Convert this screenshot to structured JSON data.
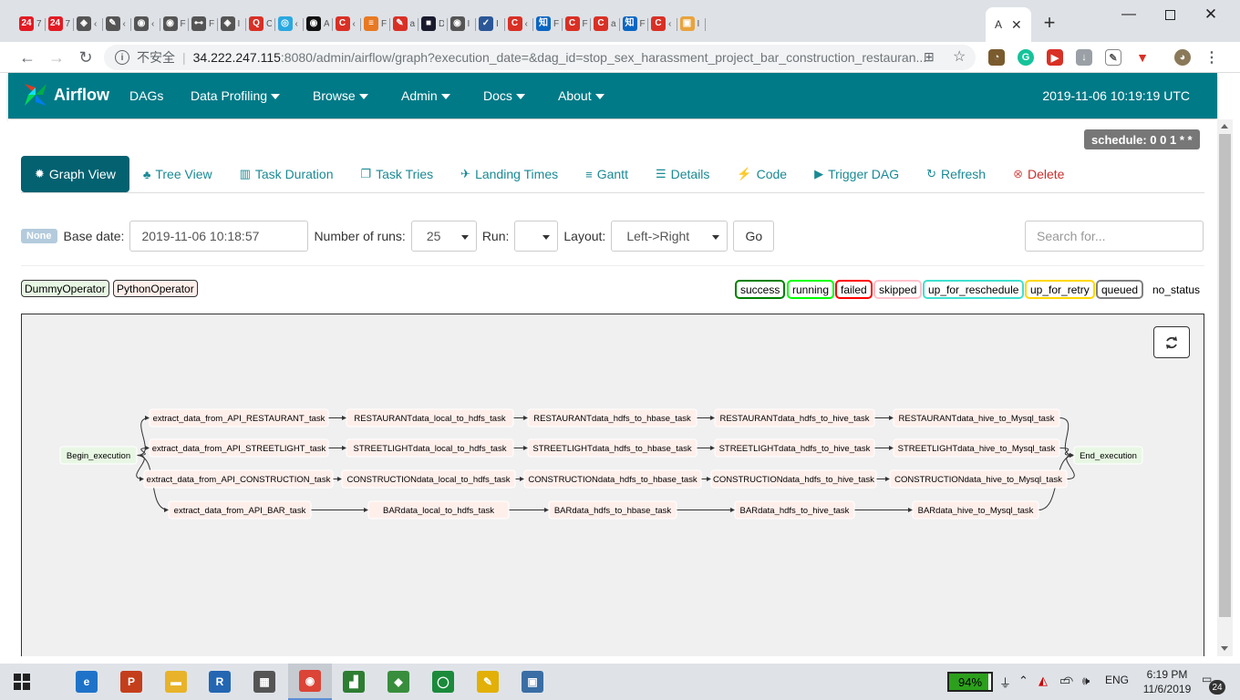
{
  "browser": {
    "tabs": [
      {
        "icon": "24-icon",
        "badge": "24",
        "color": "#e31b23",
        "label": "7"
      },
      {
        "icon": "24-icon",
        "badge": "24",
        "color": "#e31b23",
        "label": "7"
      },
      {
        "icon": "diamond-icon",
        "badge": "◈",
        "color": "#555",
        "label": "‹"
      },
      {
        "icon": "tool-icon",
        "badge": "✎",
        "color": "#555",
        "label": "‹"
      },
      {
        "icon": "globe-icon",
        "badge": "◉",
        "color": "#555",
        "label": "‹"
      },
      {
        "icon": "globe-icon",
        "badge": "◉",
        "color": "#555",
        "label": "F"
      },
      {
        "icon": "network-icon",
        "badge": "⊷",
        "color": "#555",
        "label": "F"
      },
      {
        "icon": "diamond-icon",
        "badge": "◈",
        "color": "#555",
        "label": "I"
      },
      {
        "icon": "q-icon",
        "badge": "Q",
        "color": "#d93025",
        "label": "C"
      },
      {
        "icon": "app-icon",
        "badge": "◎",
        "color": "#2aa8e0",
        "label": "‹"
      },
      {
        "icon": "github-icon",
        "badge": "◉",
        "color": "#111",
        "label": "A"
      },
      {
        "icon": "c-icon",
        "badge": "C",
        "color": "#d93025",
        "label": "‹"
      },
      {
        "icon": "stack-icon",
        "badge": "≡",
        "color": "#e87922",
        "label": "F"
      },
      {
        "icon": "pen-icon",
        "badge": "✎",
        "color": "#d93025",
        "label": "a"
      },
      {
        "icon": "dark-icon",
        "badge": "■",
        "color": "#1a1a2e",
        "label": "D"
      },
      {
        "icon": "globe-icon",
        "badge": "◉",
        "color": "#555",
        "label": "I"
      },
      {
        "icon": "flag-icon",
        "badge": "✓",
        "color": "#2b5797",
        "label": "I"
      },
      {
        "icon": "c-icon",
        "badge": "C",
        "color": "#d93025",
        "label": "‹"
      },
      {
        "icon": "zhi-icon",
        "badge": "知",
        "color": "#0a66c2",
        "label": "F"
      },
      {
        "icon": "c-icon",
        "badge": "C",
        "color": "#d93025",
        "label": "F"
      },
      {
        "icon": "c-icon",
        "badge": "C",
        "color": "#d93025",
        "label": "a"
      },
      {
        "icon": "zhi-icon",
        "badge": "知",
        "color": "#0a66c2",
        "label": "F"
      },
      {
        "icon": "c-icon",
        "badge": "C",
        "color": "#d93025",
        "label": "‹"
      },
      {
        "icon": "box-icon",
        "badge": "▣",
        "color": "#e8a33d",
        "label": "I"
      }
    ],
    "active_tab_label": "A",
    "new_tab": "+",
    "address": {
      "insecure_label": "不安全",
      "separator": "|",
      "host": "34.222.247.115",
      "rest": ":8080/admin/airflow/graph?execution_date=&dag_id=stop_sex_harassment_project_bar_construction_restauran..."
    }
  },
  "airflow": {
    "brand": "Airflow",
    "menu": [
      {
        "label": "DAGs",
        "caret": false
      },
      {
        "label": "Data Profiling",
        "caret": true
      },
      {
        "label": "Browse",
        "caret": true
      },
      {
        "label": "Admin",
        "caret": true
      },
      {
        "label": "Docs",
        "caret": true
      },
      {
        "label": "About",
        "caret": true
      }
    ],
    "server_time": "2019-11-06 10:19:19 UTC",
    "schedule": "schedule: 0 0 1 * *",
    "view_tabs": [
      {
        "icon": "✹",
        "label": "Graph View",
        "active": true
      },
      {
        "icon": "♣",
        "label": "Tree View"
      },
      {
        "icon": "▥",
        "label": "Task Duration"
      },
      {
        "icon": "❐",
        "label": "Task Tries"
      },
      {
        "icon": "✈",
        "label": "Landing Times"
      },
      {
        "icon": "≡",
        "label": "Gantt"
      },
      {
        "icon": "☰",
        "label": "Details"
      },
      {
        "icon": "⚡",
        "label": "Code"
      },
      {
        "icon": "▶",
        "label": "Trigger DAG"
      },
      {
        "icon": "↻",
        "label": "Refresh"
      },
      {
        "icon": "⊗",
        "label": "Delete"
      }
    ],
    "form": {
      "none_badge": "None",
      "base_date_label": "Base date:",
      "base_date_value": "2019-11-06 10:18:57",
      "runs_label": "Number of runs:",
      "runs_value": "25",
      "run_label": "Run:",
      "run_value": "",
      "layout_label": "Layout:",
      "layout_value": "Left->Right",
      "go_label": "Go",
      "search_placeholder": "Search for..."
    },
    "operators": [
      {
        "label": "DummyOperator",
        "bg": "#e8f7e4"
      },
      {
        "label": "PythonOperator",
        "bg": "#ffefeb"
      }
    ],
    "states": [
      {
        "label": "success",
        "color": "#008000"
      },
      {
        "label": "running",
        "color": "#00ff00"
      },
      {
        "label": "failed",
        "color": "#ff0000"
      },
      {
        "label": "skipped",
        "color": "#ffc0cb"
      },
      {
        "label": "up_for_reschedule",
        "color": "#40e0d0"
      },
      {
        "label": "up_for_retry",
        "color": "#ffd700"
      },
      {
        "label": "queued",
        "color": "#808080"
      },
      {
        "label": "no_status",
        "color": "#ffffff"
      }
    ],
    "graph": {
      "start": "Begin_execution",
      "end": "End_execution",
      "rows": [
        [
          "extract_data_from_API_RESTAURANT_task",
          "RESTAURANTdata_local_to_hdfs_task",
          "RESTAURANTdata_hdfs_to_hbase_task",
          "RESTAURANTdata_hdfs_to_hive_task",
          "RESTAURANTdata_hive_to_Mysql_task"
        ],
        [
          "extract_data_from_API_STREETLIGHT_task",
          "STREETLIGHTdata_local_to_hdfs_task",
          "STREETLIGHTdata_hdfs_to_hbase_task",
          "STREETLIGHTdata_hdfs_to_hive_task",
          "STREETLIGHTdata_hive_to_Mysql_task"
        ],
        [
          "extract_data_from_API_CONSTRUCTION_task",
          "CONSTRUCTIONdata_local_to_hdfs_task",
          "CONSTRUCTIONdata_hdfs_to_hbase_task",
          "CONSTRUCTIONdata_hdfs_to_hive_task",
          "CONSTRUCTIONdata_hive_to_Mysql_task"
        ],
        [
          "extract_data_from_API_BAR_task",
          "BARdata_local_to_hdfs_task",
          "BARdata_hdfs_to_hbase_task",
          "BARdata_hdfs_to_hive_task",
          "BARdata_hive_to_Mysql_task"
        ]
      ]
    }
  },
  "taskbar": {
    "apps": [
      {
        "name": "edge-icon",
        "glyph": "e",
        "color": "#1e73c9"
      },
      {
        "name": "powerpoint-icon",
        "glyph": "P",
        "color": "#c43e1c"
      },
      {
        "name": "file-explorer-icon",
        "glyph": "▬",
        "color": "#e8b32a"
      },
      {
        "name": "r-icon",
        "glyph": "R",
        "color": "#2466b2"
      },
      {
        "name": "store-icon",
        "glyph": "▦",
        "color": "#555"
      },
      {
        "name": "chrome-icon",
        "glyph": "◉",
        "color": "#db4437"
      },
      {
        "name": "chart-app-icon",
        "glyph": "▟",
        "color": "#2e7d32"
      },
      {
        "name": "diamond-app-icon",
        "glyph": "◆",
        "color": "#388e3c"
      },
      {
        "name": "ring-app-icon",
        "glyph": "◯",
        "color": "#1b8a3b"
      },
      {
        "name": "tool-app-icon",
        "glyph": "✎",
        "color": "#e2b007"
      },
      {
        "name": "remote-app-icon",
        "glyph": "▣",
        "color": "#3a6ea5"
      }
    ],
    "battery": "94%",
    "battery_level": 0.94,
    "language": "ENG",
    "time": "6:19 PM",
    "date": "11/6/2019",
    "notifications": "24"
  }
}
